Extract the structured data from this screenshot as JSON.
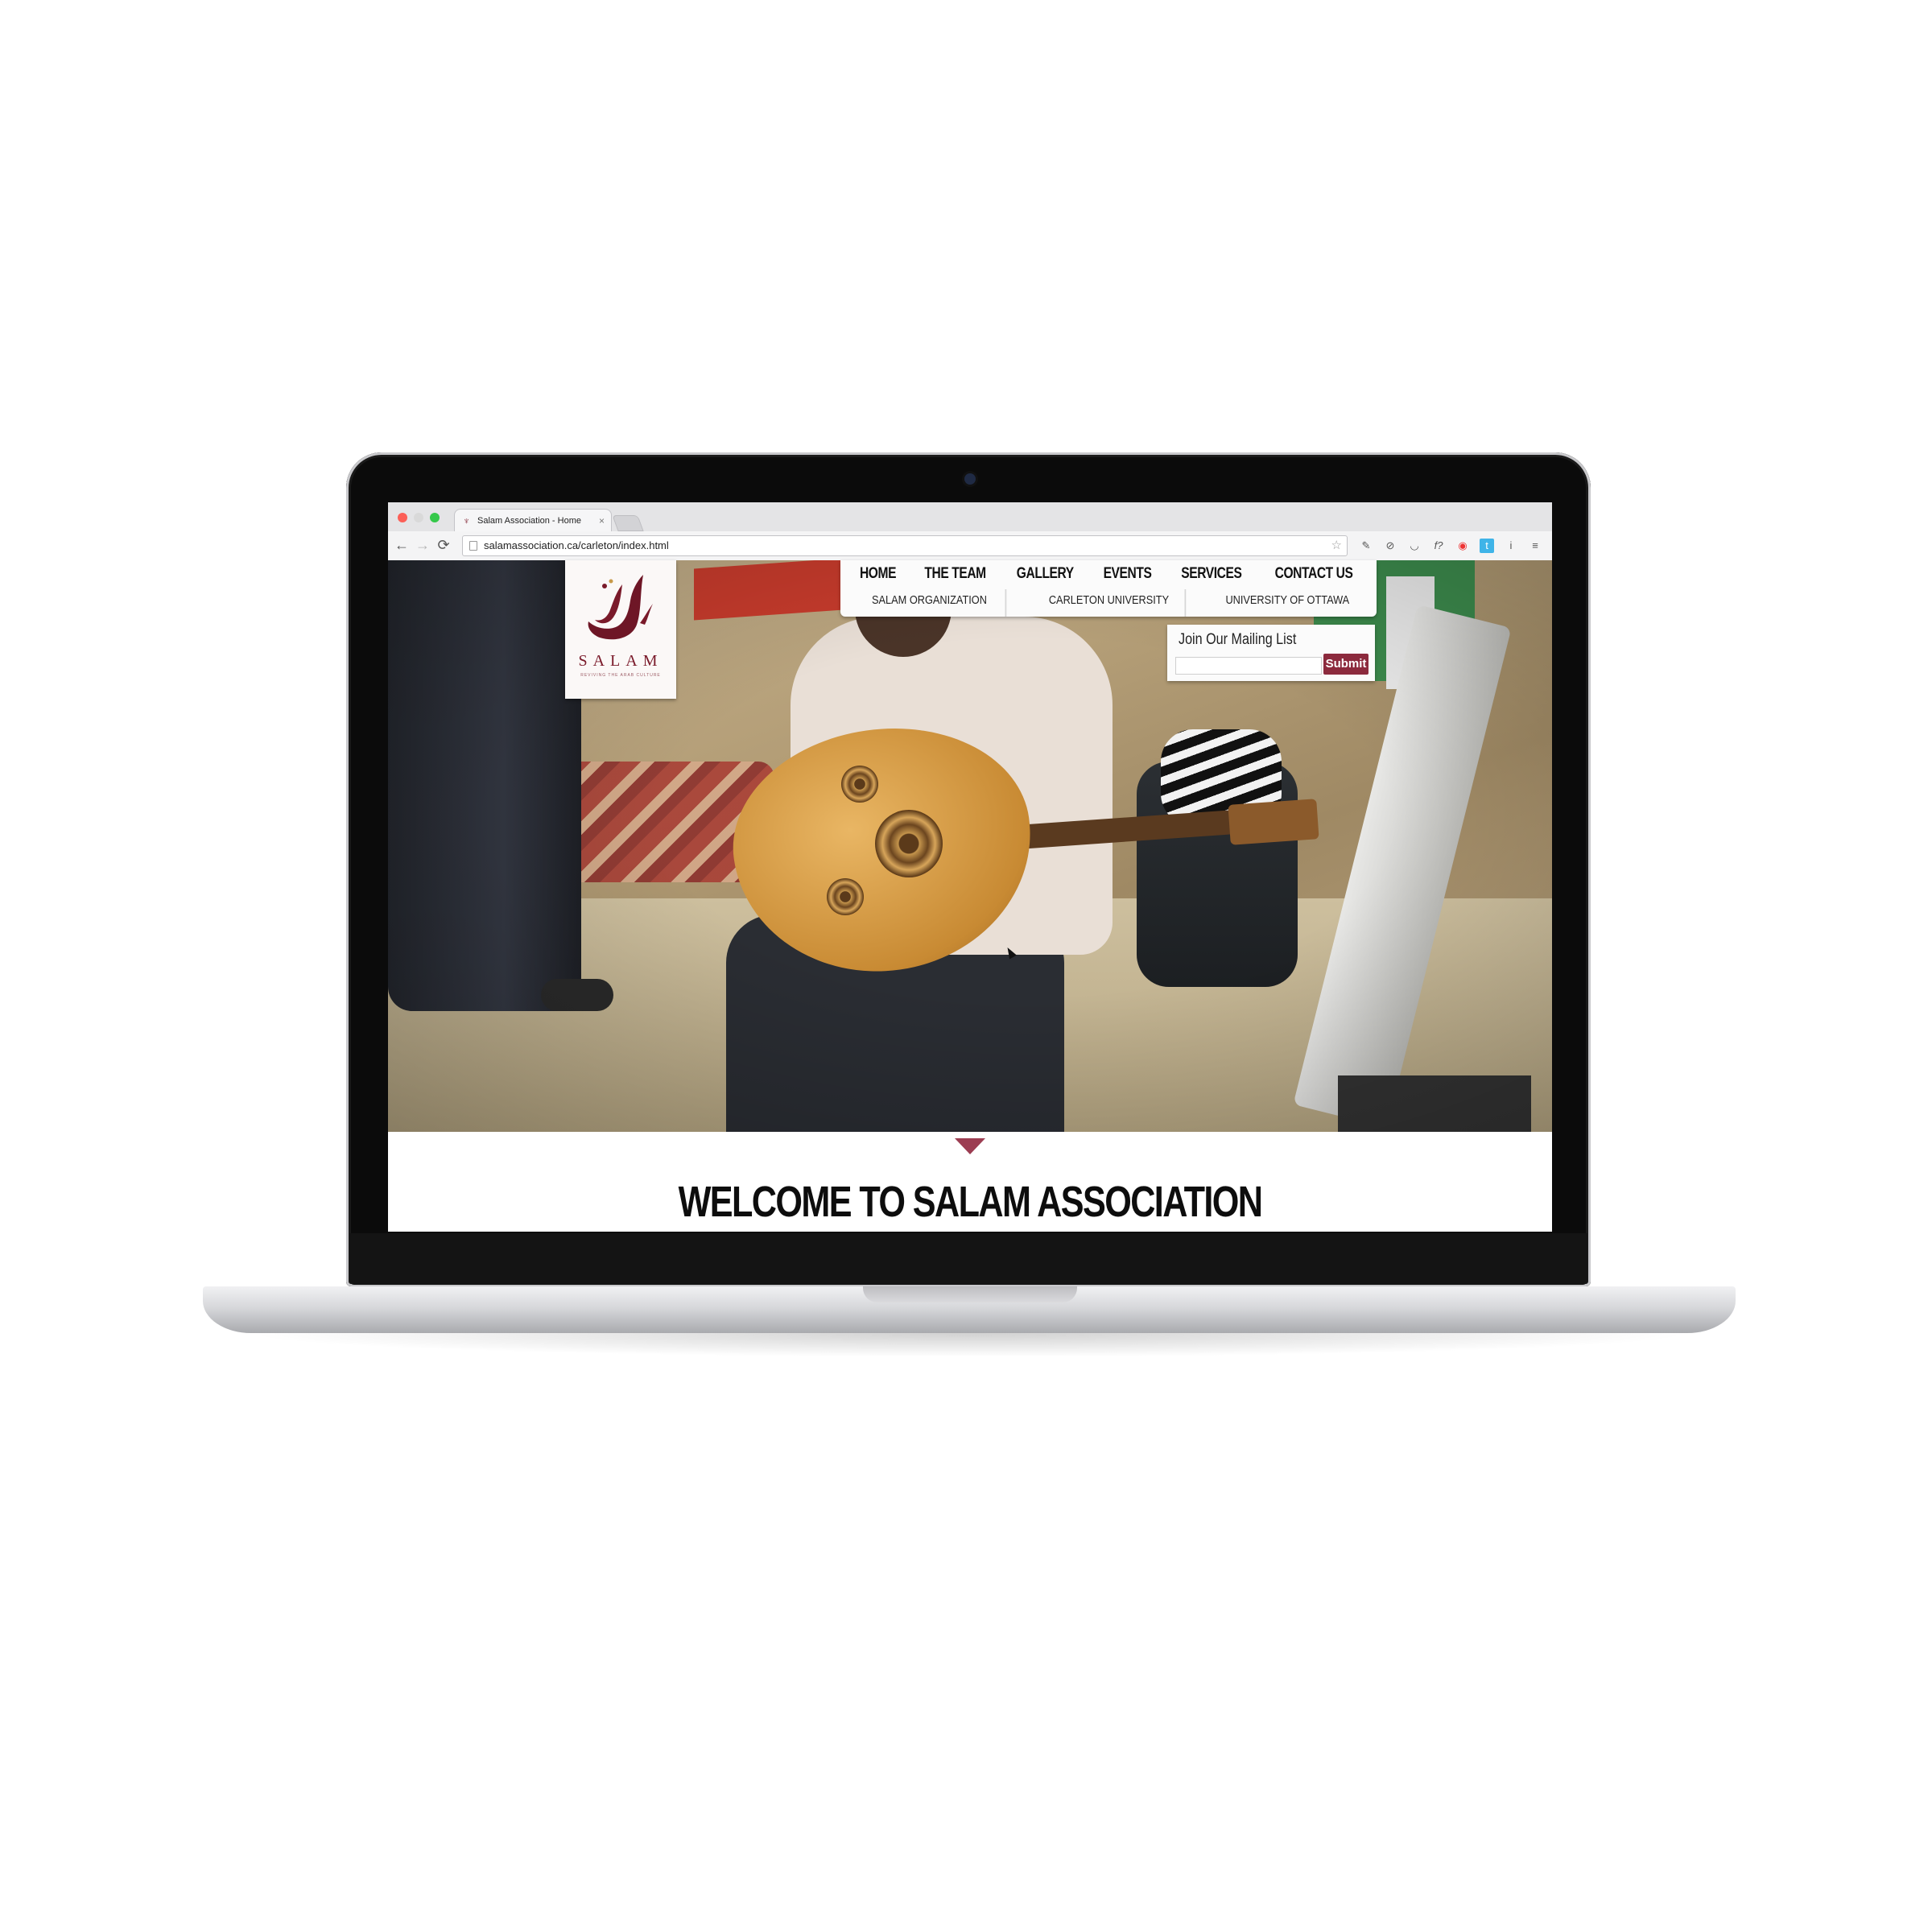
{
  "browser": {
    "tab_title": "Salam Association - Home",
    "tab_close": "×",
    "url": "salamassociation.ca/carleton/index.html",
    "nav_back": "←",
    "nav_forward": "→",
    "nav_reload": "C",
    "bookmark_star": "☆",
    "extensions": [
      "eyedropper-icon",
      "block-icon",
      "pocket-icon",
      "font-icon",
      "opera-icon",
      "twitter-icon",
      "info-icon",
      "menu-icon"
    ],
    "extension_glyphs": [
      "✎",
      "⊘",
      "◡",
      "f?",
      "◉",
      "t",
      "i",
      "≡"
    ]
  },
  "site": {
    "logo_word": "SALAM",
    "logo_tagline": "REVIVING THE ARAB CULTURE",
    "menu": [
      "HOME",
      "THE TEAM",
      "GALLERY",
      "EVENTS",
      "SERVICES",
      "CONTACT US"
    ],
    "submenu": [
      "SALAM ORGANIZATION",
      "CARLETON UNIVERSITY",
      "UNIVERSITY OF OTTAWA"
    ],
    "mailing_list": {
      "title": "Join Our Mailing List",
      "input_value": "",
      "submit_label": "Submit"
    },
    "welcome_heading": "WELCOME TO SALAM ASSOCIATION",
    "colors": {
      "accent": "#8c2a3d",
      "logo": "#7a1a2a"
    }
  }
}
